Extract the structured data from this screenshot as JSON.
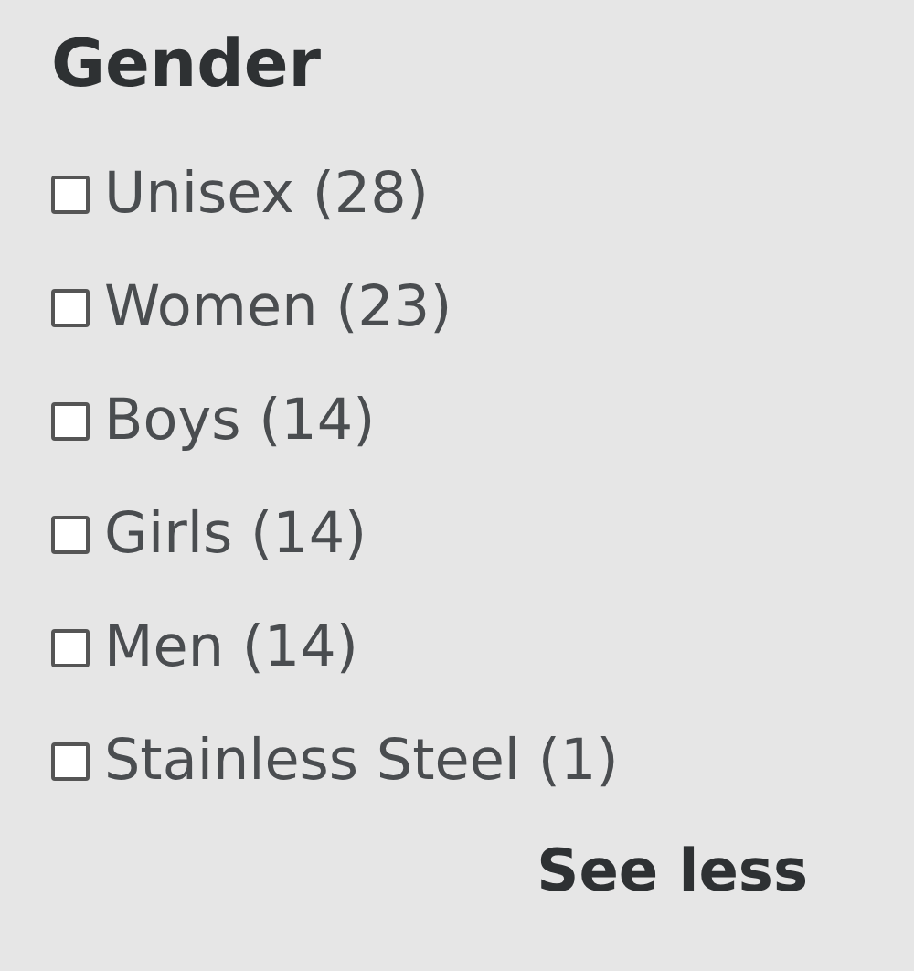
{
  "heading": "Gender",
  "options": [
    {
      "label": "Unisex (28)",
      "checked": false
    },
    {
      "label": "Women (23)",
      "checked": false
    },
    {
      "label": "Boys (14)",
      "checked": false
    },
    {
      "label": "Girls (14)",
      "checked": false
    },
    {
      "label": "Men (14)",
      "checked": false
    },
    {
      "label": "Stainless Steel (1)",
      "checked": false
    }
  ],
  "toggle_link": "See less"
}
